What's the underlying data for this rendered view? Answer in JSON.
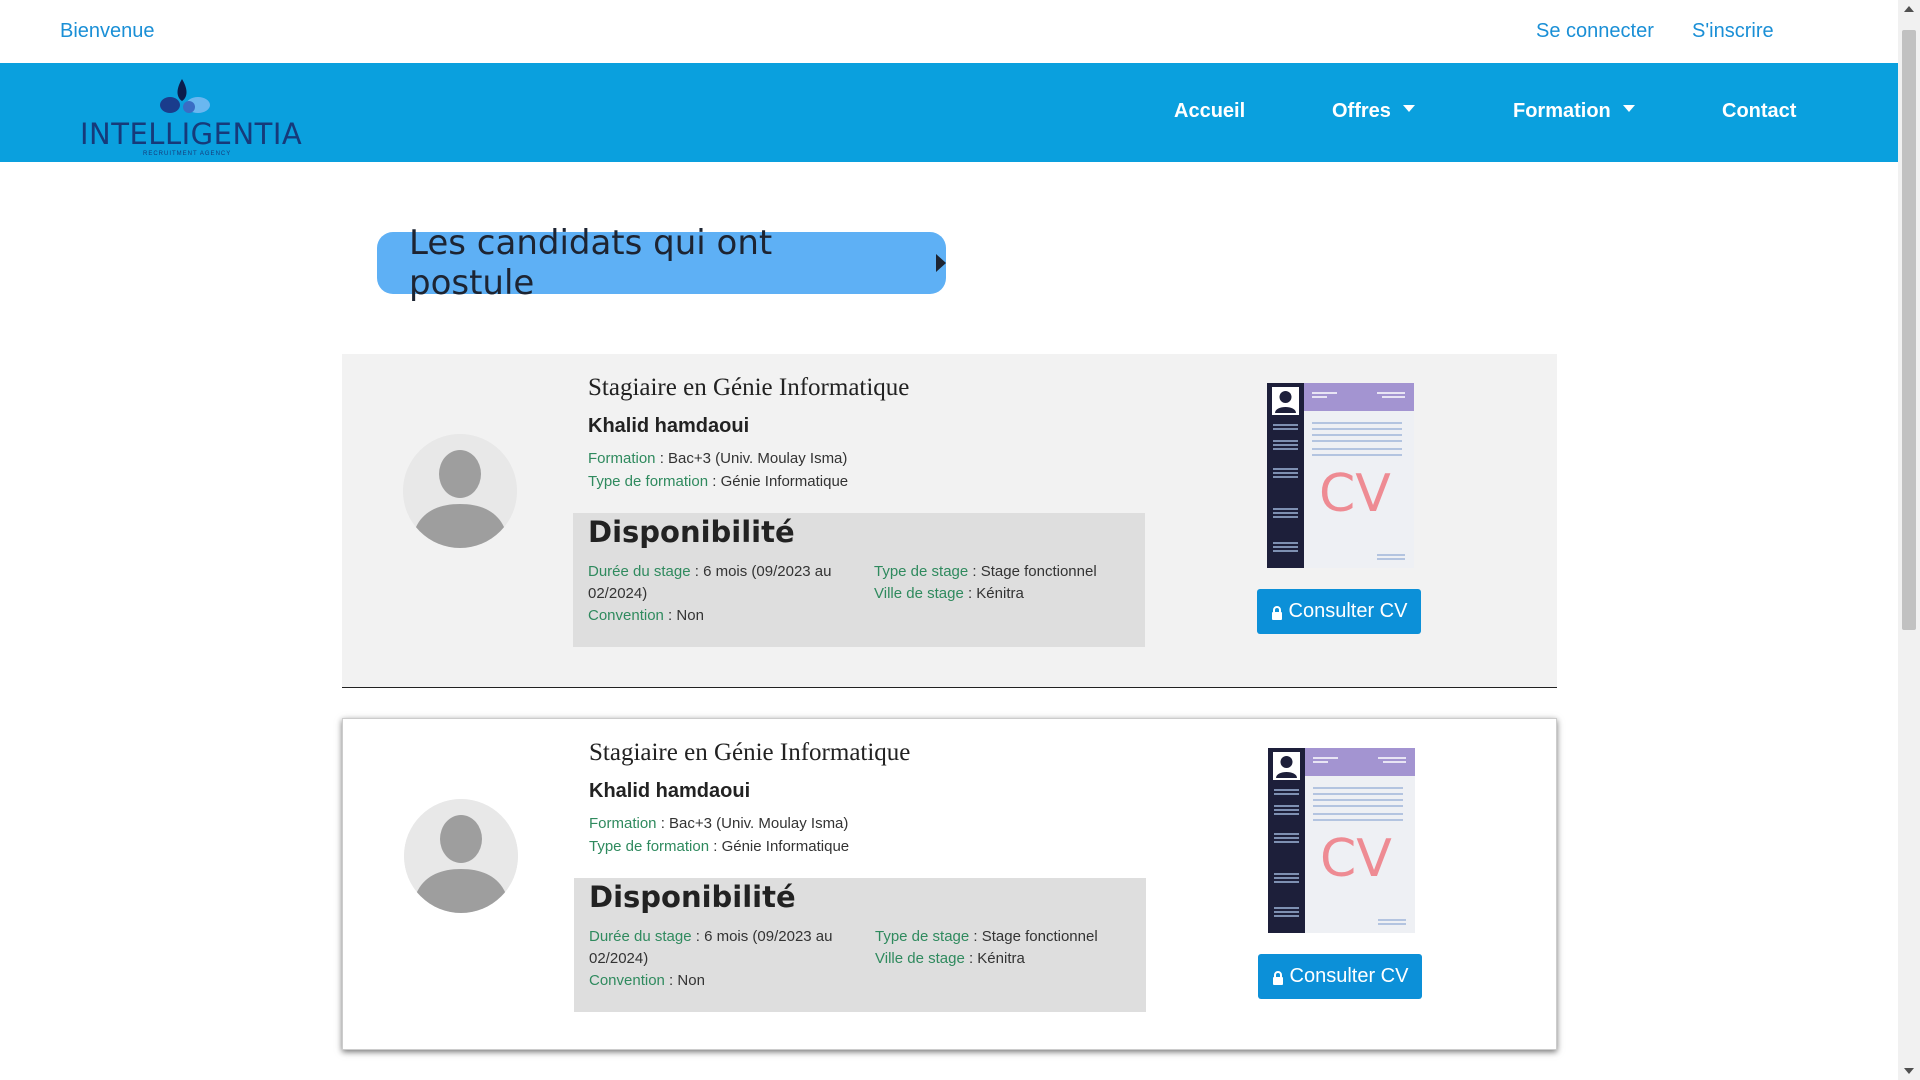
{
  "topbar": {
    "welcome": "Bienvenue",
    "login": "Se connecter",
    "signup": "S'inscrire"
  },
  "logo": {
    "name": "INTELLIGENTIA",
    "subtitle": "RECRUITMENT AGENCY"
  },
  "nav": {
    "items": [
      {
        "label": "Accueil",
        "dropdown": false
      },
      {
        "label": "Offres",
        "dropdown": true
      },
      {
        "label": "Formation",
        "dropdown": true
      },
      {
        "label": "Contact",
        "dropdown": false
      }
    ]
  },
  "heading": "Les candidats qui ont postule",
  "candidates": [
    {
      "job_title": "Stagiaire en Génie Informatique",
      "name": "Khalid hamdaoui",
      "formation_label": "Formation",
      "formation_value": " : Bac+3 (Univ. Moulay Isma)",
      "type_formation_label": "Type de formation",
      "type_formation_value": " : Génie Informatique",
      "dispo_title": "Disponibilité",
      "duree_label": "Durée du stage",
      "duree_value": " : 6 mois (09/2023 au 02/2024)",
      "convention_label": "Convention",
      "convention_value": " : Non",
      "type_stage_label": "Type de stage",
      "type_stage_value": " : Stage fonctionnel",
      "ville_label": "Ville de stage",
      "ville_value": " : Kénitra",
      "cv_button": "Consulter CV",
      "cv_text": "CV"
    },
    {
      "job_title": "Stagiaire en Génie Informatique",
      "name": "Khalid hamdaoui",
      "formation_label": "Formation",
      "formation_value": " : Bac+3 (Univ. Moulay Isma)",
      "type_formation_label": "Type de formation",
      "type_formation_value": " : Génie Informatique",
      "dispo_title": "Disponibilité",
      "duree_label": "Durée du stage",
      "duree_value": " : 6 mois (09/2023 au 02/2024)",
      "convention_label": "Convention",
      "convention_value": " : Non",
      "type_stage_label": "Type de stage",
      "type_stage_value": " : Stage fonctionnel",
      "ville_label": "Ville de stage",
      "ville_value": " : Kénitra",
      "cv_button": "Consulter CV",
      "cv_text": "CV"
    }
  ],
  "colors": {
    "navbar": "#0aa0de",
    "heading_pill": "#5eb0f5",
    "link": "#1a8fd6",
    "button": "#0c90d8",
    "label_green": "#2f8a5e"
  }
}
